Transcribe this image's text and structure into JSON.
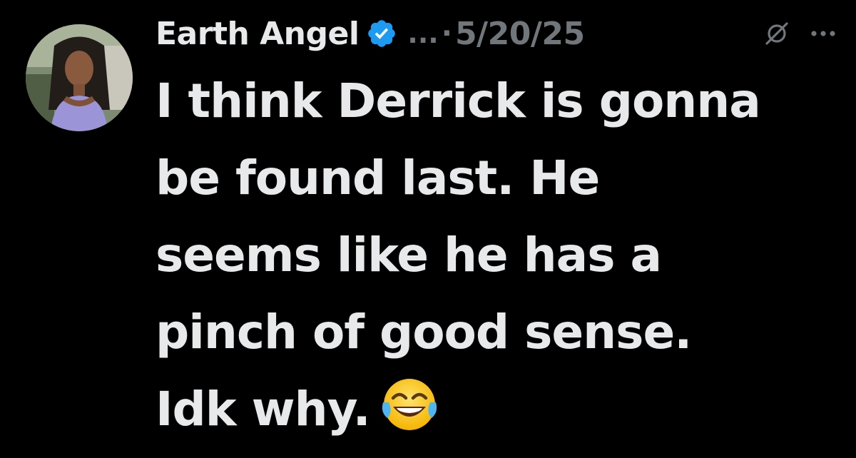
{
  "tweet": {
    "author": {
      "display_name": "Earth Angel",
      "verified_icon": "verified-badge-icon",
      "handle_truncated": "...",
      "separator": "·",
      "avatar_icon": "profile-avatar"
    },
    "date": "5/20/25",
    "actions": {
      "grok_icon": "grok-icon",
      "more_icon": "more-options-icon"
    },
    "text_lines": [
      "I think Derrick is gonna",
      "be found last. He",
      "seems like he has a",
      "pinch of good sense.",
      "Idk why."
    ],
    "emoji": "face-with-tears-of-joy-icon"
  },
  "colors": {
    "background": "#000000",
    "text_primary": "#e7e9ea",
    "text_secondary": "#71767b",
    "verified_blue": "#1d9bf0"
  }
}
